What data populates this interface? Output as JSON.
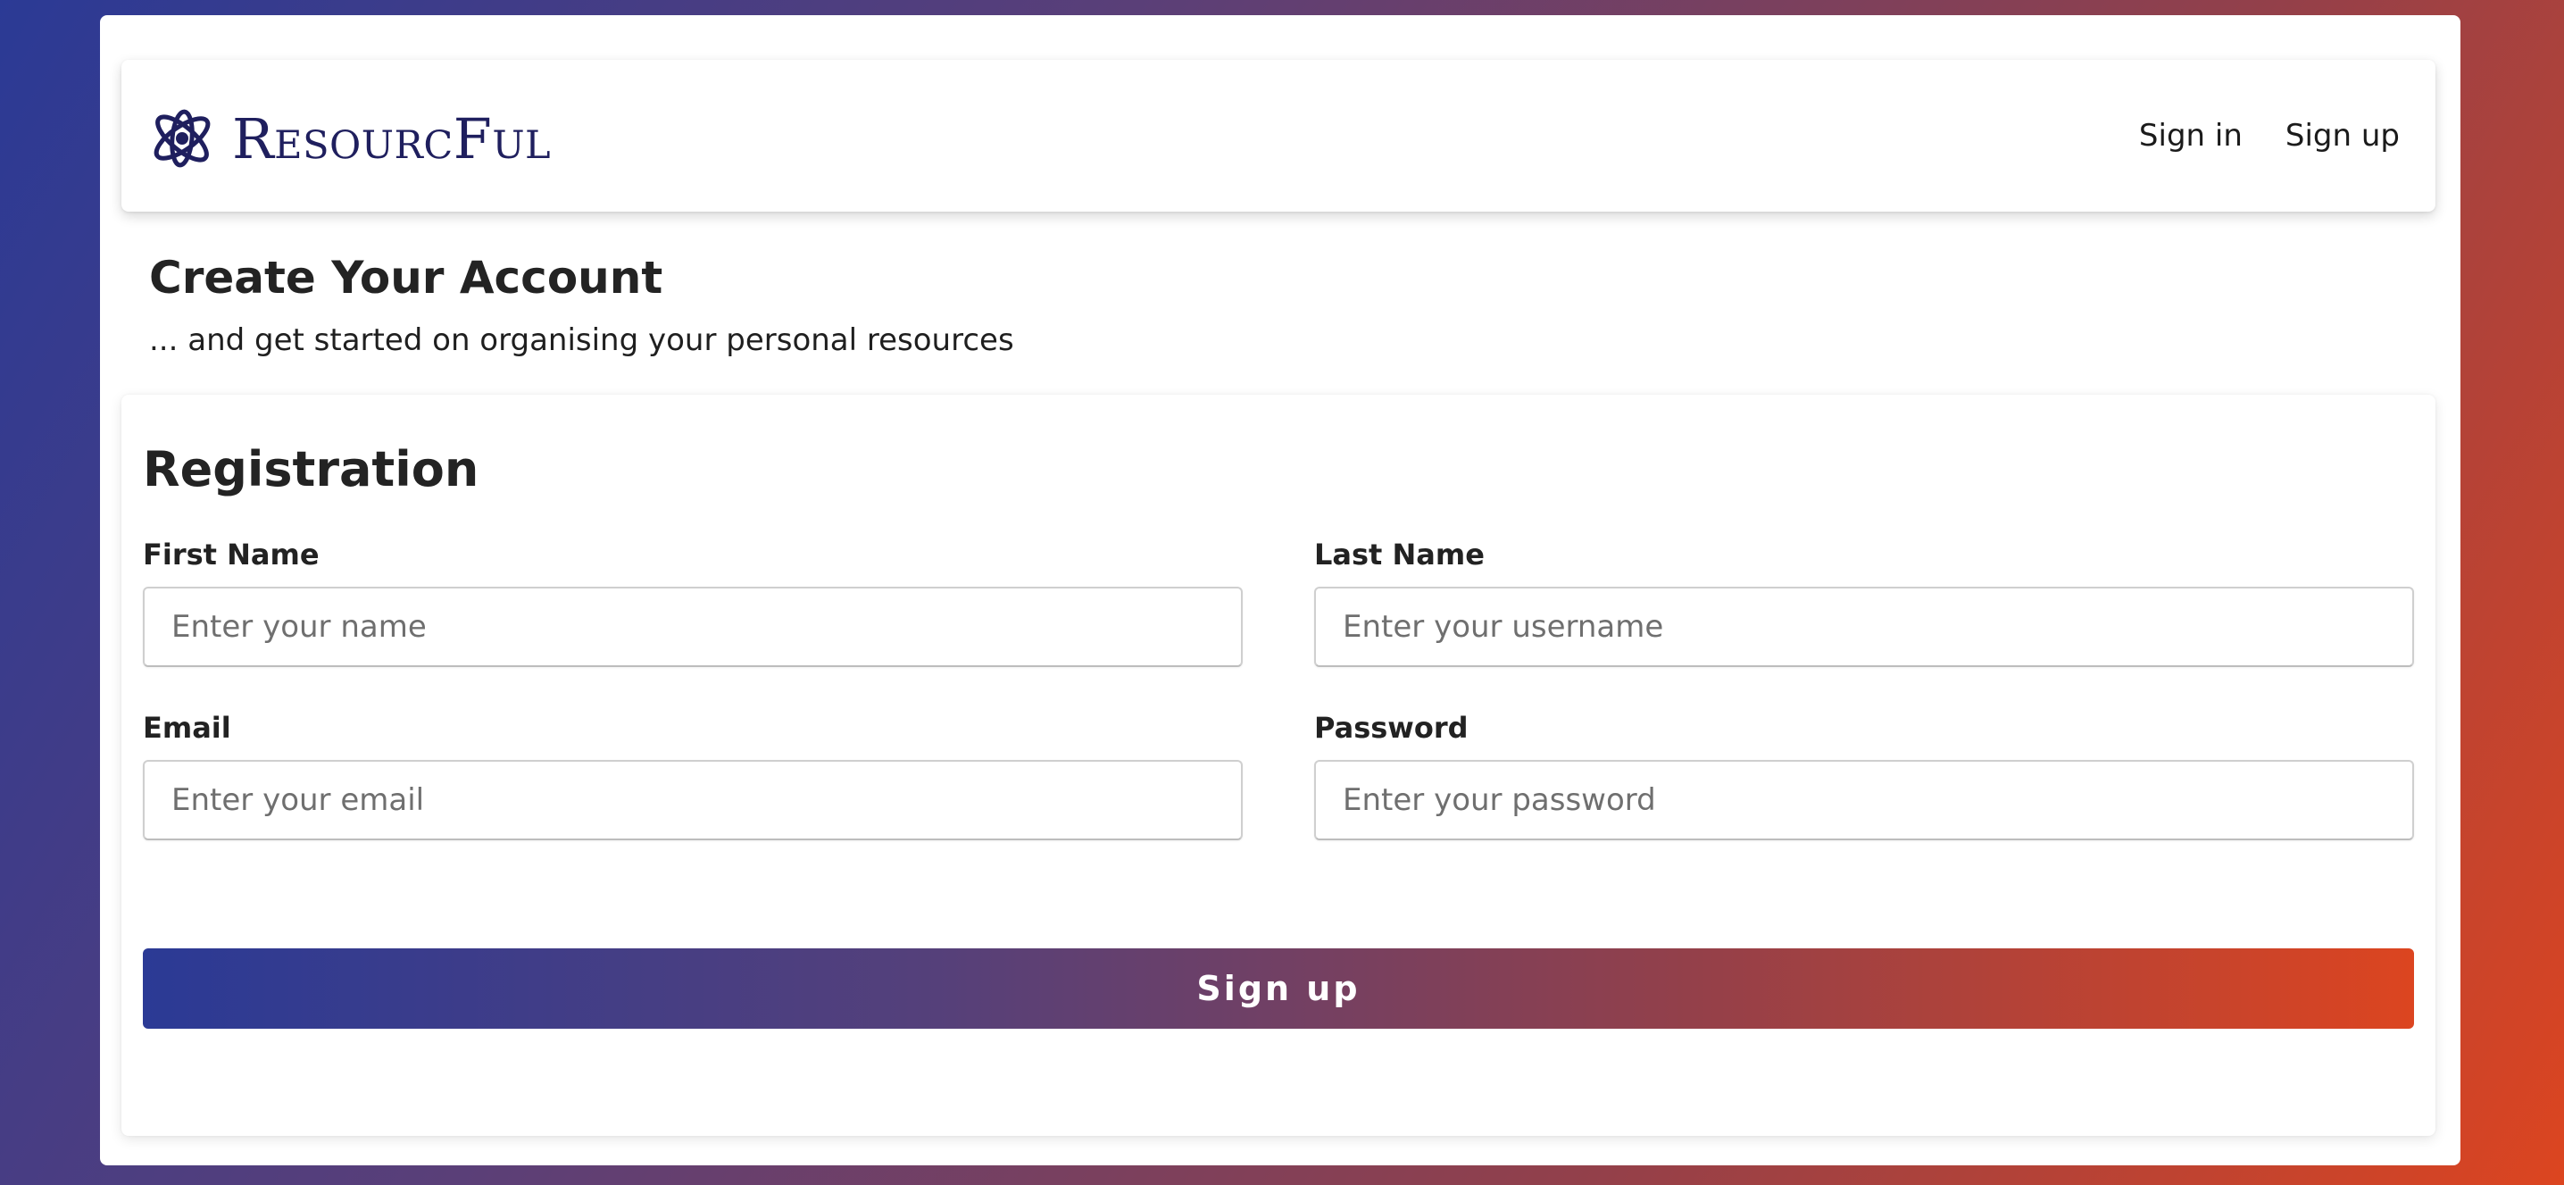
{
  "header": {
    "brand_name": "ResourcFul",
    "logo_icon": "orbit-logo-icon",
    "nav": [
      {
        "label": "Sign in"
      },
      {
        "label": "Sign up"
      }
    ]
  },
  "intro": {
    "title": "Create Your Account",
    "subtitle": "... and get started on organising your personal resources"
  },
  "form": {
    "title": "Registration",
    "fields": {
      "first_name": {
        "label": "First Name",
        "placeholder": "Enter your name",
        "value": ""
      },
      "last_name": {
        "label": "Last Name",
        "placeholder": "Enter your username",
        "value": ""
      },
      "email": {
        "label": "Email",
        "placeholder": "Enter your email",
        "value": ""
      },
      "password": {
        "label": "Password",
        "placeholder": "Enter your password",
        "value": ""
      }
    },
    "submit_label": "Sign up"
  },
  "colors": {
    "brand_text": "#1f1f5e",
    "gradient_start": "#2b3a95",
    "gradient_end": "#dc4520"
  }
}
